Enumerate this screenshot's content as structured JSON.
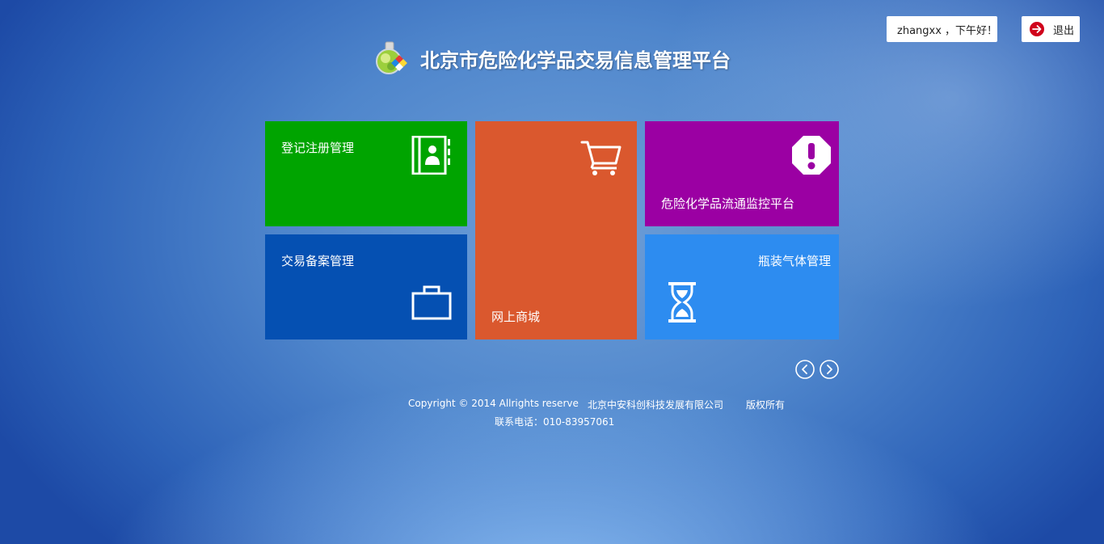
{
  "header": {
    "title": "北京市危险化学品交易信息管理平台",
    "logo_icon": "flask-logo-icon"
  },
  "user": {
    "greeting": "zhangxx ，下午好！",
    "icon": "person-icon"
  },
  "logout": {
    "label": "退出",
    "icon": "arrow-right-circle-icon",
    "icon_color": "#d0021b"
  },
  "tiles": [
    {
      "id": "register",
      "label": "登记注册管理",
      "icon": "contact-book-icon",
      "color": "#00a400"
    },
    {
      "id": "shop",
      "label": "网上商城",
      "icon": "shopping-cart-icon",
      "color": "#da582e"
    },
    {
      "id": "monitor",
      "label": "危险化学品流通监控平台",
      "icon": "exclamation-octagon-icon",
      "color": "#9b00a3"
    },
    {
      "id": "trade",
      "label": "交易备案管理",
      "icon": "briefcase-icon",
      "color": "#0550b2"
    },
    {
      "id": "gas",
      "label": "瓶装气体管理",
      "icon": "hourglass-icon",
      "color": "#2d8cf0"
    }
  ],
  "pager": {
    "prev_icon": "chevron-left-circle-icon",
    "next_icon": "chevron-right-circle-icon"
  },
  "footer": {
    "copyright": "Copyright © 2014 Allrights reserve",
    "company": "北京中安科创科技发展有限公司",
    "rights": "版权所有",
    "phone": "联系电话：010-83957061"
  }
}
